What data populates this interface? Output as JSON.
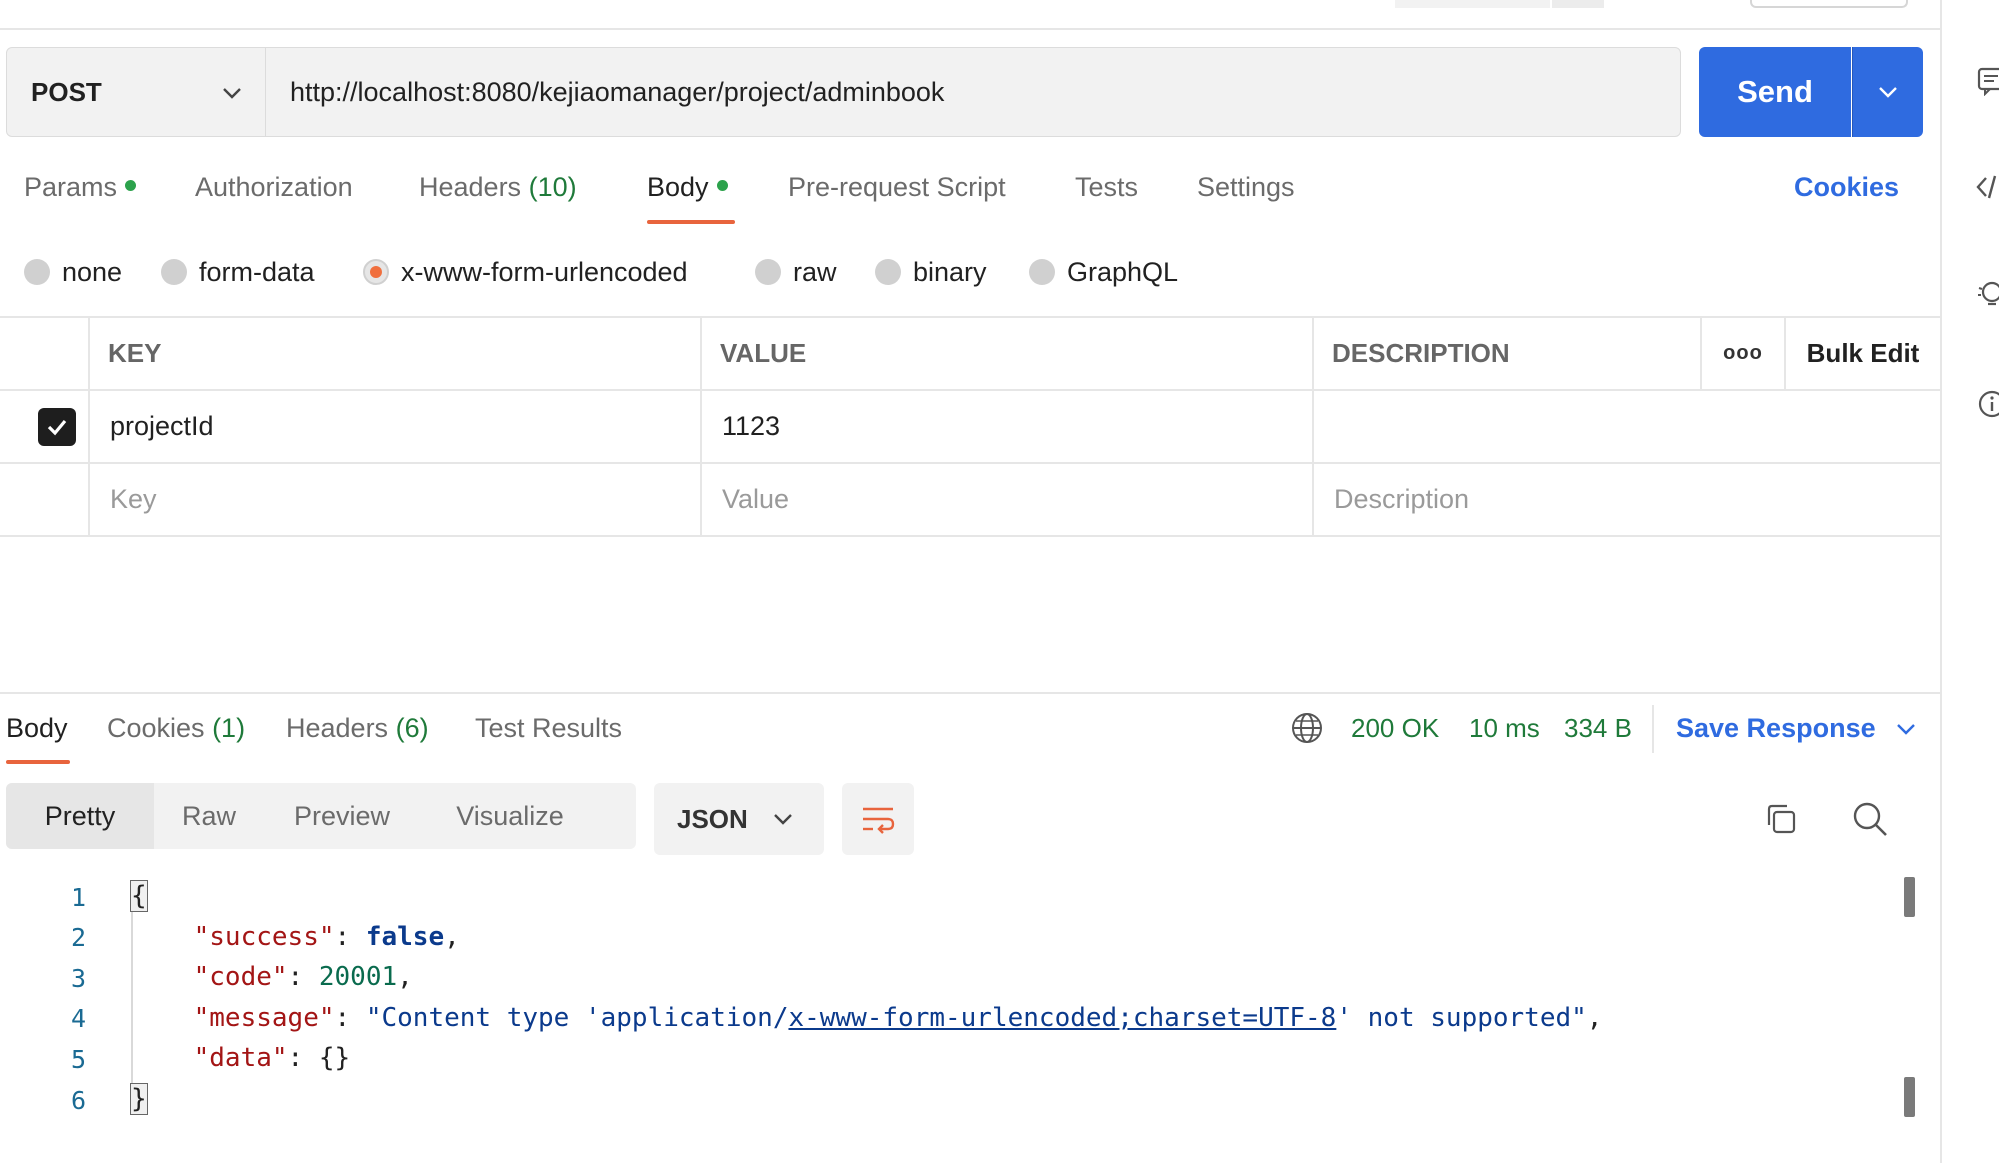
{
  "request": {
    "method": "POST",
    "url": "http://localhost:8080/kejiaomanager/project/adminbook",
    "send_label": "Send"
  },
  "request_tabs": {
    "params": "Params",
    "authorization": "Authorization",
    "headers": "Headers",
    "headers_count": "(10)",
    "body": "Body",
    "pre_request": "Pre-request Script",
    "tests": "Tests",
    "settings": "Settings",
    "cookies": "Cookies"
  },
  "body_types": {
    "none": "none",
    "form_data": "form-data",
    "urlencoded": "x-www-form-urlencoded",
    "raw": "raw",
    "binary": "binary",
    "graphql": "GraphQL",
    "selected": "x-www-form-urlencoded"
  },
  "params_table": {
    "headers": {
      "key": "KEY",
      "value": "VALUE",
      "description": "DESCRIPTION",
      "more": "ooo",
      "bulk_edit": "Bulk Edit"
    },
    "rows": [
      {
        "checked": true,
        "key": "projectId",
        "value": "1123",
        "description": ""
      }
    ],
    "placeholders": {
      "key": "Key",
      "value": "Value",
      "description": "Description"
    }
  },
  "response_tabs": {
    "body": "Body",
    "cookies": "Cookies",
    "cookies_count": "(1)",
    "headers": "Headers",
    "headers_count": "(6)",
    "test_results": "Test Results"
  },
  "response_status": {
    "status": "200 OK",
    "time": "10 ms",
    "size": "334 B",
    "save_response": "Save Response"
  },
  "view_modes": {
    "pretty": "Pretty",
    "raw": "Raw",
    "preview": "Preview",
    "visualize": "Visualize",
    "format": "JSON"
  },
  "response_body": {
    "line_numbers": [
      "1",
      "2",
      "3",
      "4",
      "5",
      "6"
    ],
    "open_brace": "{",
    "close_brace": "}",
    "success_key": "\"success\"",
    "success_value": "false",
    "code_key": "\"code\"",
    "code_value": "20001",
    "message_key": "\"message\"",
    "message_prefix": "\"Content type 'application/",
    "message_link": "x-www-form-urlencoded;charset=UTF-8",
    "message_suffix": "' not supported\"",
    "data_key": "\"data\"",
    "data_value": "{}"
  },
  "colors": {
    "accent_blue": "#2f6be0",
    "active_orange": "#e8643d",
    "status_green": "#1f7a3a",
    "dot_green": "#2ca24c"
  }
}
